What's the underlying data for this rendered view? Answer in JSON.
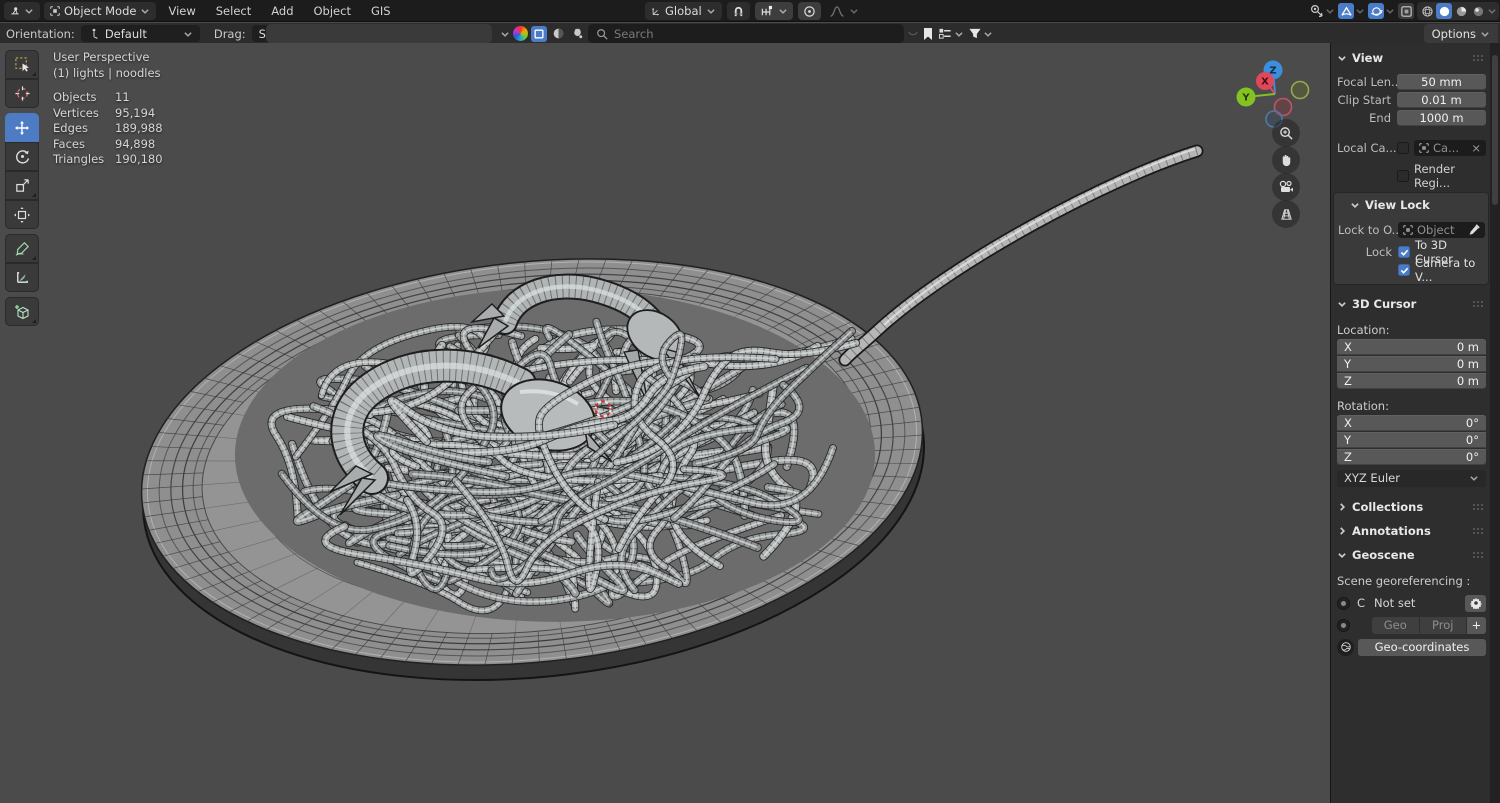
{
  "topbar": {
    "mode_label": "Object Mode",
    "menus": [
      "View",
      "Select",
      "Add",
      "Object",
      "GIS"
    ],
    "orientation_value": "Global",
    "options_label": "Options"
  },
  "toolsettings": {
    "orientation_label": "Orientation:",
    "orientation_value": "Default",
    "drag_label": "Drag:",
    "drag_value": "Select Box",
    "search_placeholder": "Search"
  },
  "viewport": {
    "overlay": {
      "perspective": "User Perspective",
      "scene": "(1) lights | noodles",
      "stats": [
        {
          "label": "Objects",
          "value": "11"
        },
        {
          "label": "Vertices",
          "value": "95,194"
        },
        {
          "label": "Edges",
          "value": "189,988"
        },
        {
          "label": "Faces",
          "value": "94,898"
        },
        {
          "label": "Triangles",
          "value": "190,180"
        }
      ]
    },
    "gizmo_axes": [
      "X",
      "Y",
      "Z"
    ]
  },
  "sidebar": {
    "view": {
      "title": "View",
      "fields": [
        {
          "label": "Focal Len...",
          "value": "50 mm"
        },
        {
          "label": "Clip Start",
          "value": "0.01 m"
        },
        {
          "label": "End",
          "value": "1000 m"
        }
      ],
      "local_camera_label": "Local Ca...",
      "local_camera_value": "Ca...",
      "local_camera_close": "×",
      "render_region_label": "Render Regi..."
    },
    "view_lock": {
      "title": "View Lock",
      "lock_to_label": "Lock to O...",
      "lock_to_value": "Object",
      "lock_label": "Lock",
      "checkbox1": "To 3D Cursor",
      "checkbox2": "Camera to V..."
    },
    "cursor": {
      "title": "3D Cursor",
      "location_label": "Location:",
      "location": [
        {
          "axis": "X",
          "value": "0 m"
        },
        {
          "axis": "Y",
          "value": "0 m"
        },
        {
          "axis": "Z",
          "value": "0 m"
        }
      ],
      "rotation_label": "Rotation:",
      "rotation": [
        {
          "axis": "X",
          "value": "0°"
        },
        {
          "axis": "Y",
          "value": "0°"
        },
        {
          "axis": "Z",
          "value": "0°"
        }
      ],
      "euler": "XYZ Euler"
    },
    "collections_title": "Collections",
    "annotations_title": "Annotations",
    "geoscene": {
      "title": "Geoscene",
      "georef_label": "Scene georeferencing :",
      "crs_letter": "C",
      "crs_value": "Not set",
      "geo_btn": "Geo",
      "proj_btn": "Proj",
      "add_btn": "+",
      "geocoords_btn": "Geo-coordinates"
    }
  },
  "colors": {
    "accent_blue": "#4a7cc8",
    "axis_x": "#e0485a",
    "axis_y": "#84c122",
    "axis_z": "#3d8fdd",
    "viewport_bg": "#4b4b4b",
    "noodle_light": "#aeb2b2",
    "noodle_dark": "#202020"
  }
}
